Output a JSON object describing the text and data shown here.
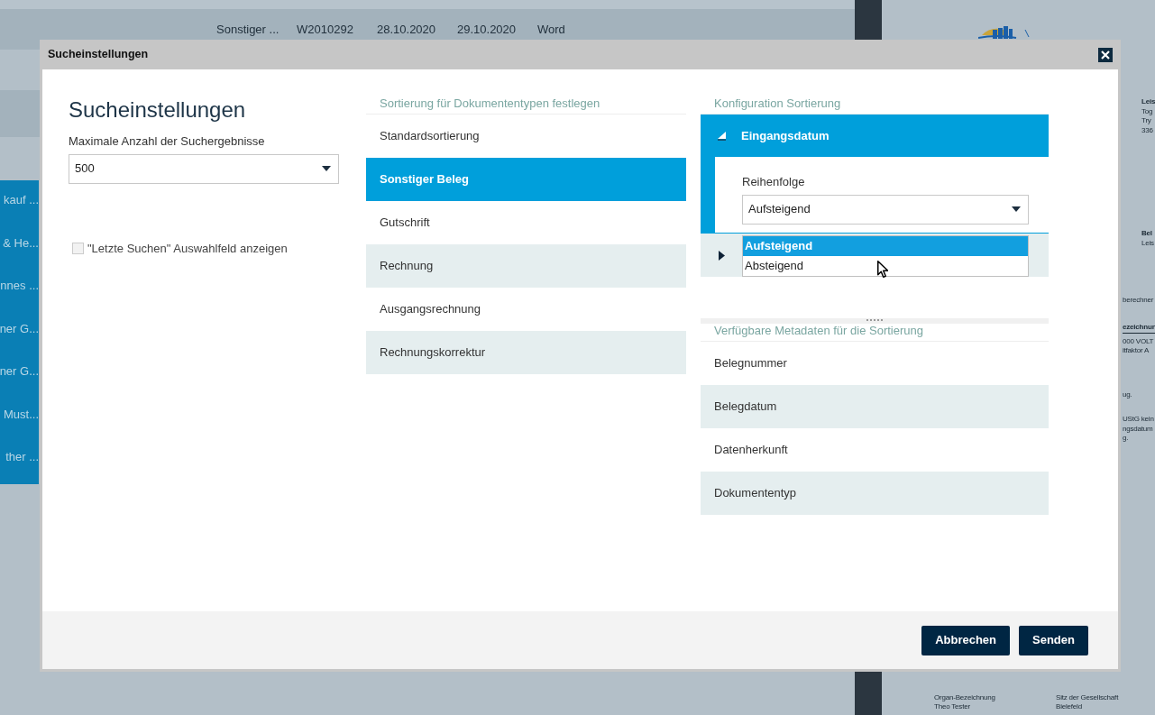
{
  "background": {
    "table_row": [
      "Sonstiger ...",
      "W2010292",
      "28.10.2020",
      "29.10.2020",
      "Word"
    ],
    "sidebar_items": [
      "kauf ...",
      "& He...",
      "nnes ...",
      "ner G...",
      "ner G...",
      "Must...",
      "ther ..."
    ],
    "document_blocks": [
      {
        "kind": "address",
        "lines": [
          "Leis",
          "Tog",
          "Try",
          "336"
        ]
      },
      {
        "kind": "address",
        "lines": [
          "Bel",
          "Leis"
        ]
      },
      {
        "kind": "text",
        "lines": [
          "berechner"
        ]
      },
      {
        "kind": "table",
        "lines": [
          "ezeichnun",
          "000 VOLT",
          "itfaktor A"
        ]
      },
      {
        "kind": "text",
        "lines": [
          "ug."
        ]
      },
      {
        "kind": "text",
        "lines": [
          "UStG kein",
          "ngsdatum",
          "g."
        ]
      }
    ],
    "footer_blocks": [
      {
        "lines": [
          "Organ-Bezeichnung",
          "Theo Tester"
        ]
      },
      {
        "lines": [
          "Sitz der Gesellschaft",
          "Bielefeld"
        ]
      }
    ]
  },
  "dialog": {
    "title": "Sucheinstellungen",
    "heading": "Sucheinstellungen",
    "max_results": {
      "label": "Maximale Anzahl der Suchergebnisse",
      "value": "500"
    },
    "recent_checkbox": {
      "label": "\"Letzte Suchen\" Auswahlfeld anzeigen",
      "checked": false,
      "disabled": true
    },
    "doc_types": {
      "heading": "Sortierung für Dokumententypen festlegen",
      "items": [
        {
          "label": "Standardsortierung",
          "selected": false
        },
        {
          "label": "Sonstiger Beleg",
          "selected": true
        },
        {
          "label": "Gutschrift",
          "selected": false
        },
        {
          "label": "Rechnung",
          "selected": false
        },
        {
          "label": "Ausgangsrechnung",
          "selected": false
        },
        {
          "label": "Rechnungskorrektur",
          "selected": false
        }
      ]
    },
    "config": {
      "heading": "Konfiguration Sortierung",
      "items": [
        {
          "label": "Eingangsdatum",
          "expanded": true,
          "order_label": "Reihenfolge",
          "order_value": "Aufsteigend"
        },
        {
          "expanded": false
        }
      ]
    },
    "order_dropdown": {
      "options": [
        {
          "label": "Aufsteigend",
          "selected": true
        },
        {
          "label": "Absteigend",
          "selected": false
        }
      ]
    },
    "metadata": {
      "heading": "Verfügbare Metadaten für die Sortierung",
      "items": [
        "Belegnummer",
        "Belegdatum",
        "Datenherkunft",
        "Dokumententyp"
      ]
    },
    "buttons": [
      "Abbrechen",
      "Senden"
    ]
  }
}
